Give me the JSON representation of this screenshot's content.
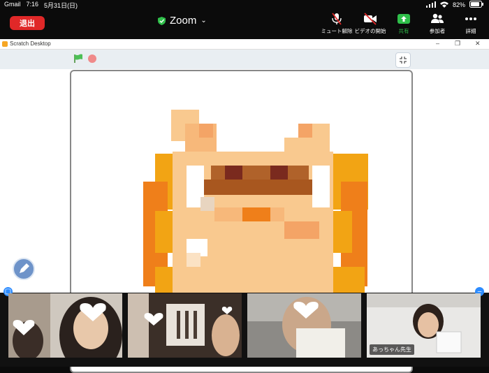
{
  "status_bar": {
    "carrier": "Gmail",
    "time": "7:16",
    "date": "5月31日(日)",
    "battery": "82%"
  },
  "zoom_bar": {
    "leave_label": "退出",
    "title": "Zoom",
    "tools": [
      {
        "label": "ミュート解除",
        "icon": "microphone-muted-icon"
      },
      {
        "label": "ビデオの開始",
        "icon": "video-off-icon"
      },
      {
        "label": "共有",
        "icon": "share-screen-icon"
      },
      {
        "label": "参加者",
        "icon": "participants-icon"
      },
      {
        "label": "詳細",
        "icon": "more-icon"
      }
    ],
    "colors": {
      "leave": "#e02828",
      "share": "#2fbf4a",
      "secure": "#2fbf4a"
    }
  },
  "window": {
    "title": "Scratch Desktop",
    "controls": [
      "–",
      "❐",
      "✕"
    ]
  },
  "scratch": {
    "controls": [
      "green-flag-icon",
      "stop-icon",
      "fullscreen-exit-icon"
    ],
    "stage": {
      "sprite": "pixel-art-cat"
    }
  },
  "participants": [
    {
      "name": "",
      "tile": "participant-1"
    },
    {
      "name": "",
      "tile": "participant-2"
    },
    {
      "name": "",
      "tile": "participant-3"
    },
    {
      "name": "あっちゃん先生",
      "tile": "participant-4"
    }
  ]
}
